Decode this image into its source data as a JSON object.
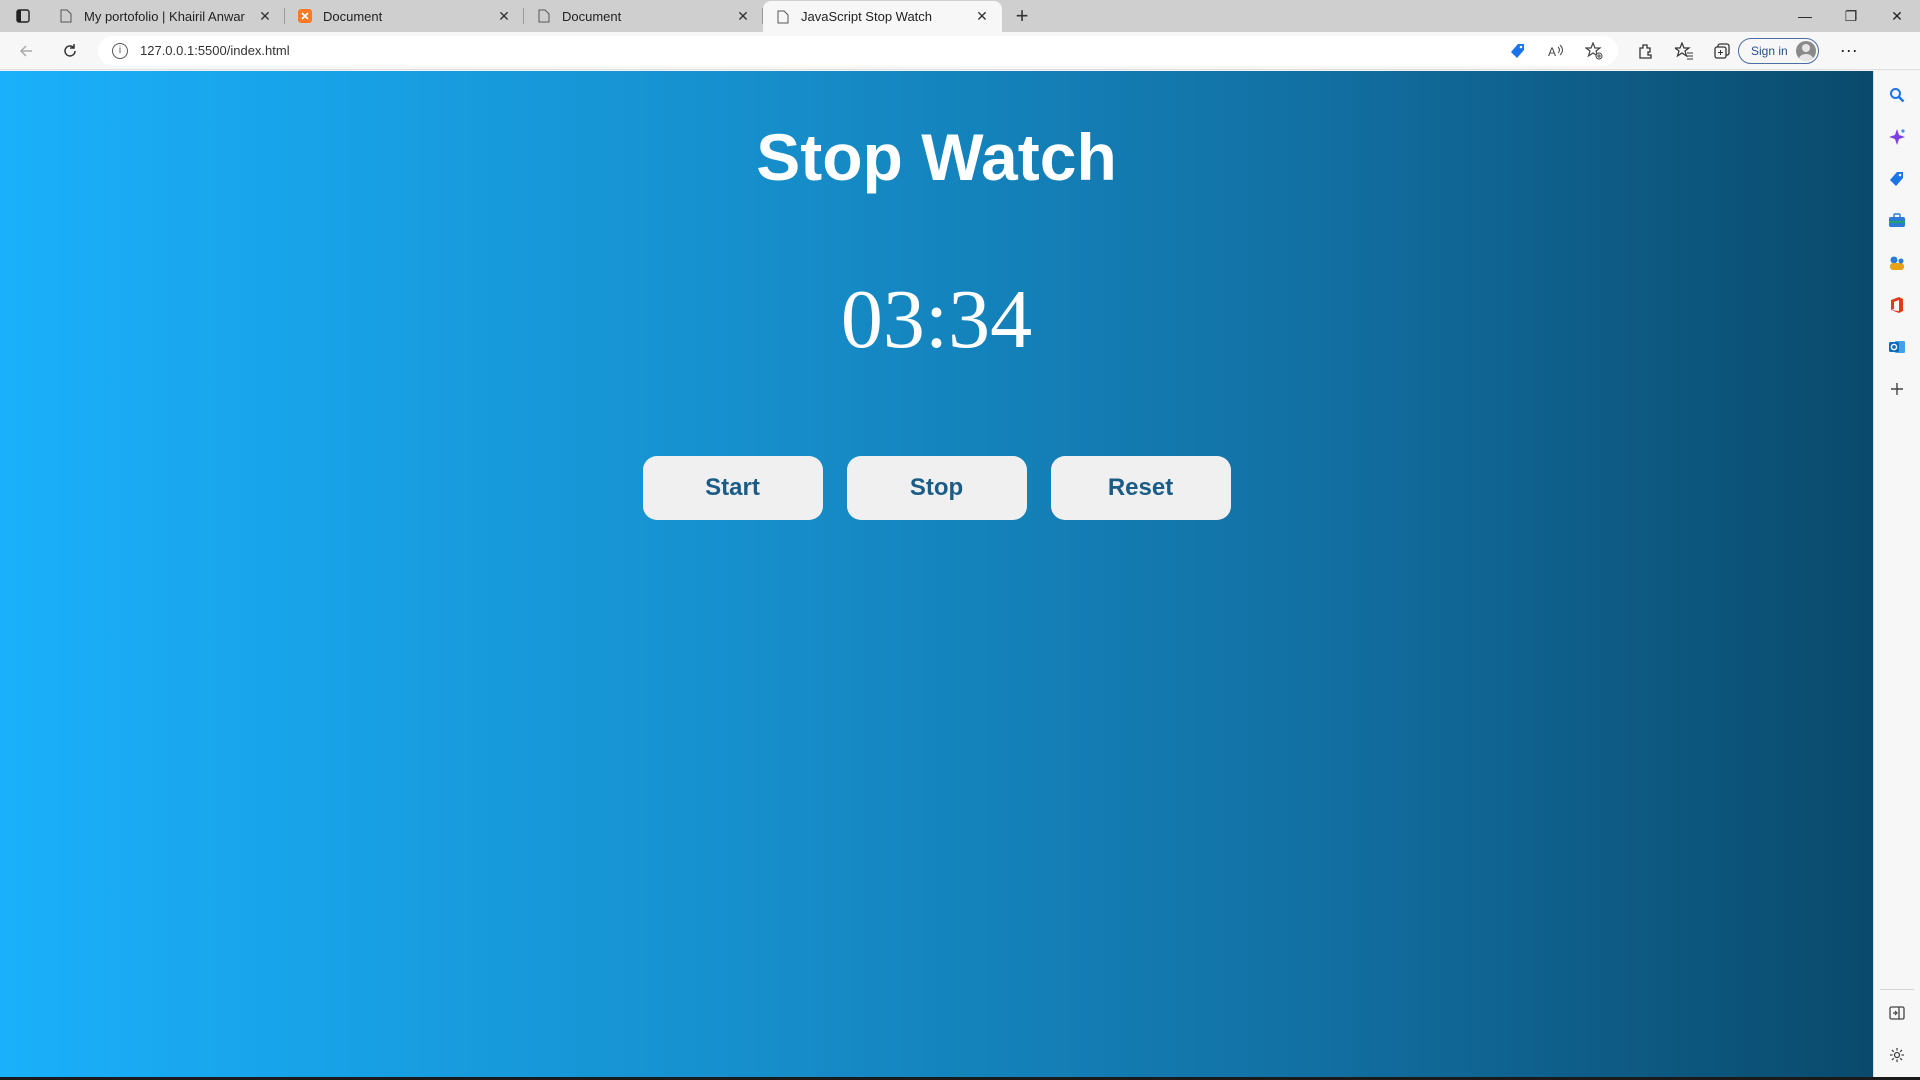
{
  "browser": {
    "tabs": [
      {
        "label": "My portofolio | Khairil Anwar",
        "favicon": "page-icon",
        "active": false
      },
      {
        "label": "Document",
        "favicon": "xampp-icon",
        "active": false
      },
      {
        "label": "Document",
        "favicon": "page-icon",
        "active": false
      },
      {
        "label": "JavaScript Stop Watch",
        "favicon": "page-icon",
        "active": true
      }
    ],
    "address": "127.0.0.1:5500/index.html",
    "signin_label": "Sign in",
    "accent_color": "#2a4f8a"
  },
  "page": {
    "title": "Stop Watch",
    "timer": "03:34",
    "buttons": {
      "start": "Start",
      "stop": "Stop",
      "reset": "Reset"
    },
    "gradient": [
      "#1ab0fb",
      "#0a4a6c"
    ],
    "button_text_color": "#1b5c86"
  },
  "sidebar": {
    "icons": [
      "search-icon",
      "copilot-icon",
      "shopping-icon",
      "tools-icon",
      "games-icon",
      "office-icon",
      "outlook-icon",
      "add-icon",
      "hide-sidebar-icon",
      "settings-icon"
    ]
  }
}
